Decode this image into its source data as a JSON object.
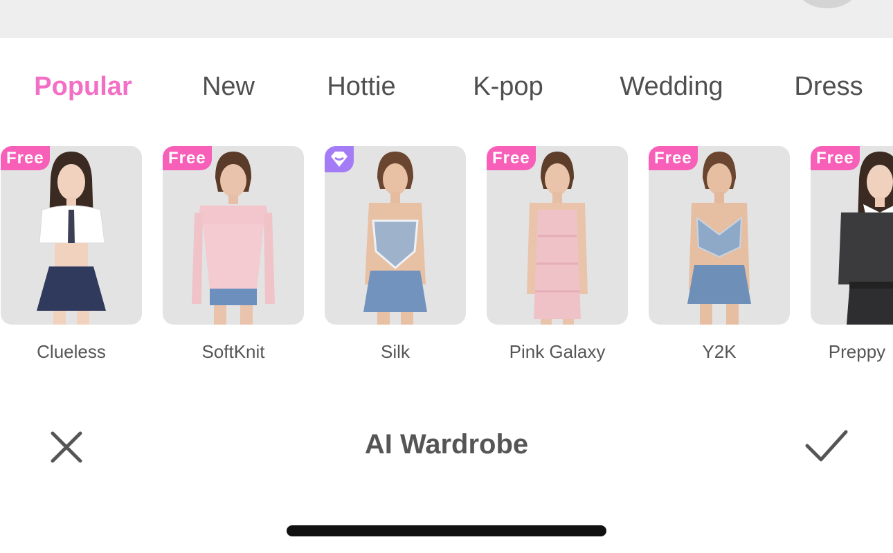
{
  "tabs": [
    {
      "label": "Popular",
      "active": true
    },
    {
      "label": "New",
      "active": false
    },
    {
      "label": "Hottie",
      "active": false
    },
    {
      "label": "K-pop",
      "active": false
    },
    {
      "label": "Wedding",
      "active": false
    },
    {
      "label": "Dress",
      "active": false
    }
  ],
  "styles": [
    {
      "name": "Clueless",
      "badge": "Free"
    },
    {
      "name": "SoftKnit",
      "badge": "Free"
    },
    {
      "name": "Silk",
      "badge": "vip-diamond-icon"
    },
    {
      "name": "Pink Galaxy",
      "badge": "Free"
    },
    {
      "name": "Y2K",
      "badge": "Free"
    },
    {
      "name": "Preppy",
      "badge": "Free"
    }
  ],
  "bottom": {
    "title": "AI Wardrobe",
    "close_icon": "close-icon",
    "confirm_icon": "checkmark-icon"
  },
  "colors": {
    "accent": "#f36fc6",
    "badge": "#f75fb8",
    "vip": "#a47cf6",
    "text": "#555555",
    "card_bg": "#e3e3e3"
  }
}
